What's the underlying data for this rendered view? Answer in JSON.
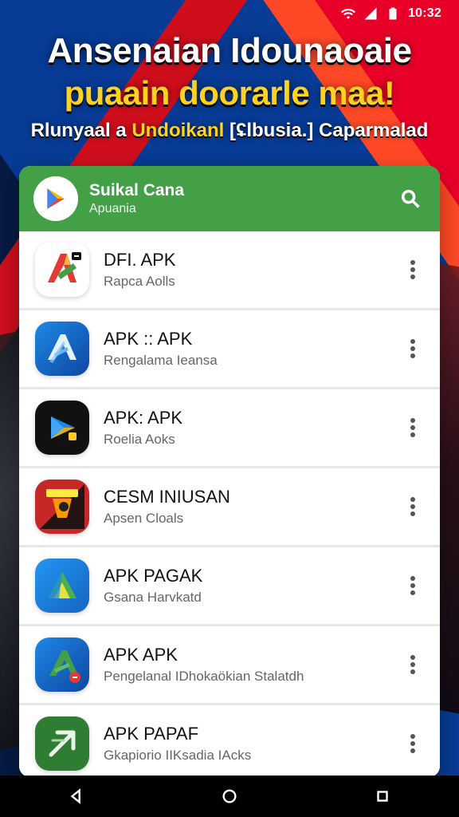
{
  "status_bar": {
    "time": "10:32",
    "icons": [
      "wifi-icon",
      "signal-icon",
      "battery-icon"
    ]
  },
  "headline": {
    "line1": "Ansenaian Idounaoaie",
    "line2": "puaain doorarle maa!",
    "line3_prefix": "Rlunyaal a ",
    "line3_accent": "Undoikanl",
    "line3_suffix": " [ʢlbusia.] Caparmalad"
  },
  "app_header": {
    "title": "Suikal Cana",
    "subtitle": "Apuania",
    "search_icon": "search-icon",
    "logo_icon": "play-logo-icon",
    "color": "#43a047"
  },
  "apps": [
    {
      "name": "DFI. APK",
      "subtitle": "Rapca Aolls",
      "icon": "apk-red-green-icon"
    },
    {
      "name": "APK :: APK",
      "subtitle": "Rengalama Ieansa",
      "icon": "apk-blue-a-icon"
    },
    {
      "name": "APK: APK",
      "subtitle": "Roelia Aoks",
      "icon": "apk-black-triangle-icon"
    },
    {
      "name": "CESM INIUSAN",
      "subtitle": "Apsen Cloals",
      "icon": "apk-red-orange-icon"
    },
    {
      "name": "APK PAGAK",
      "subtitle": "Gsana Harvkatd",
      "icon": "apk-blue-triangle-icon"
    },
    {
      "name": "APK APK",
      "subtitle": "Pengelanal IDhokaökian Stalatdh",
      "icon": "apk-blue-green-icon"
    },
    {
      "name": "APK PAPAF",
      "subtitle": "Gkapiorio IIKsadia IAcks",
      "icon": "apk-green-arrow-icon"
    }
  ],
  "nav": {
    "back_icon": "back-icon",
    "home_icon": "home-icon",
    "recents_icon": "recents-icon"
  }
}
